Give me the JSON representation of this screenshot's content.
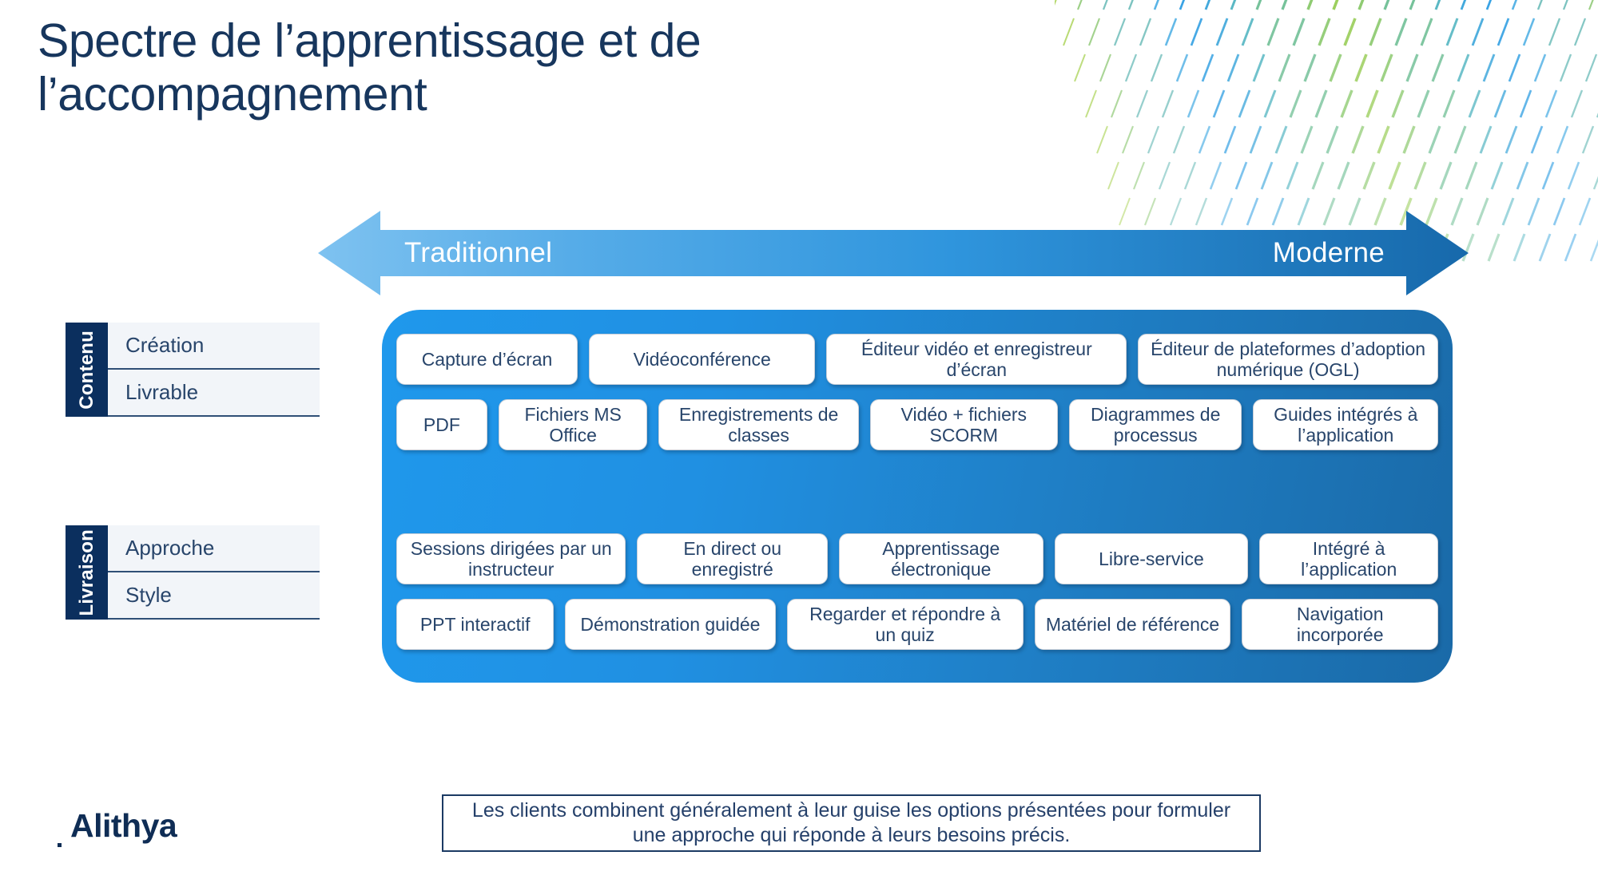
{
  "slide": {
    "title": "Spectre de l’apprentissage et de l’accompagnement",
    "brand_navy": "#0b2f5e",
    "brand_blue": "#2090e2",
    "text_navy": "#28456b"
  },
  "spectrum": {
    "left_label": "Traditionnel",
    "right_label": "Moderne"
  },
  "groups": [
    {
      "tab": "Contenu",
      "rows": [
        {
          "label": "Création"
        },
        {
          "label": "Livrable"
        }
      ]
    },
    {
      "tab": "Livraison",
      "rows": [
        {
          "label": "Approche"
        },
        {
          "label": "Style"
        }
      ]
    }
  ],
  "matrix": {
    "creation": [
      {
        "label": "Capture d’écran",
        "flex": 1.0
      },
      {
        "label": "Vidéoconférence",
        "flex": 1.28
      },
      {
        "label": "Éditeur vidéo et enregistreur d’écran",
        "flex": 1.74
      },
      {
        "label": "Éditeur de plateformes d’adoption numérique (OGL)",
        "flex": 1.74
      }
    ],
    "livrable": [
      {
        "label": "PDF",
        "flex": 0.47
      },
      {
        "label": "Fichiers MS Office",
        "flex": 0.86
      },
      {
        "label": "Enregistrements de classes",
        "flex": 1.2
      },
      {
        "label": "Vidéo + fichiers SCORM",
        "flex": 1.12
      },
      {
        "label": "Diagrammes de processus",
        "flex": 1.02
      },
      {
        "label": "Guides intégrés à l’application",
        "flex": 1.1
      }
    ],
    "approche": [
      {
        "label": "Sessions dirigées par un instructeur",
        "flex": 1.23
      },
      {
        "label": "En direct ou enregistré",
        "flex": 1.0
      },
      {
        "label": "Apprentissage électronique",
        "flex": 1.08
      },
      {
        "label": "Libre-service",
        "flex": 1.02
      },
      {
        "label": "Intégré à l’application",
        "flex": 0.93
      }
    ],
    "style": [
      {
        "label": "PPT interactif",
        "flex": 0.78
      },
      {
        "label": "Démonstration guidée",
        "flex": 1.08
      },
      {
        "label": "Regarder et répondre à un quiz",
        "flex": 1.23
      },
      {
        "label": "Matériel de référence",
        "flex": 1.0
      },
      {
        "label": "Navigation incorporée",
        "flex": 1.0
      }
    ]
  },
  "footnote": {
    "text": "Les clients combinent généralement à leur guise les options présentées pour formuler une approche qui réponde à leurs besoins précis."
  },
  "logo": {
    "name": "Alithya"
  }
}
